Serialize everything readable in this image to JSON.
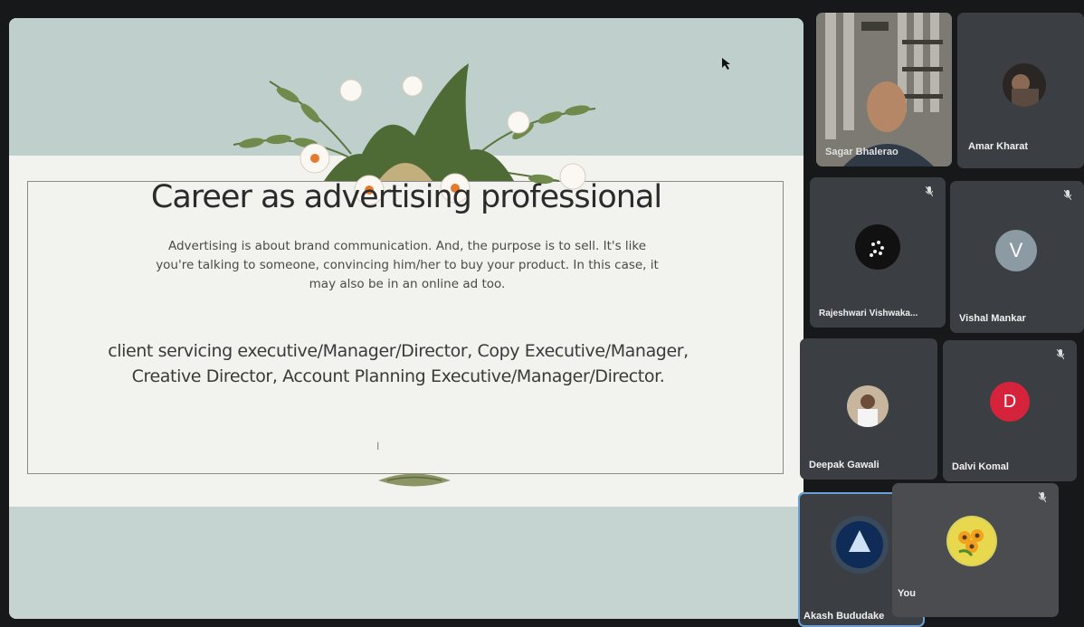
{
  "slide": {
    "title": "Career as advertising professional",
    "intro": "Advertising is about brand communication. And, the purpose is to sell. It's like you're talking to someone, convincing him/her to buy your product. In this case, it may also be in an online ad too.",
    "roles": "client servicing executive/Manager/Director, Copy Executive/Manager, Creative Director, Account Planning Executive/Manager/Director."
  },
  "participants": [
    {
      "name": "Sagar Bhalerao",
      "type": "video"
    },
    {
      "name": "Amar Kharat",
      "type": "photo"
    },
    {
      "name": "Rajeshwari Vishwaka...",
      "type": "photo",
      "muted": true
    },
    {
      "name": "Vishal Mankar",
      "type": "initial",
      "initial": "V",
      "color": "#8c9aa3",
      "muted": true
    },
    {
      "name": "Deepak Gawali",
      "type": "photo"
    },
    {
      "name": "Dalvi Komal",
      "type": "initial",
      "initial": "D",
      "color": "#d6233c",
      "muted": true
    },
    {
      "name": "Akash Bududake",
      "type": "photo",
      "active": true
    },
    {
      "name": "You",
      "type": "photo",
      "muted": true
    }
  ],
  "icons": {
    "mic_off": "mic-off-icon",
    "pointer": "mouse-pointer-icon"
  }
}
